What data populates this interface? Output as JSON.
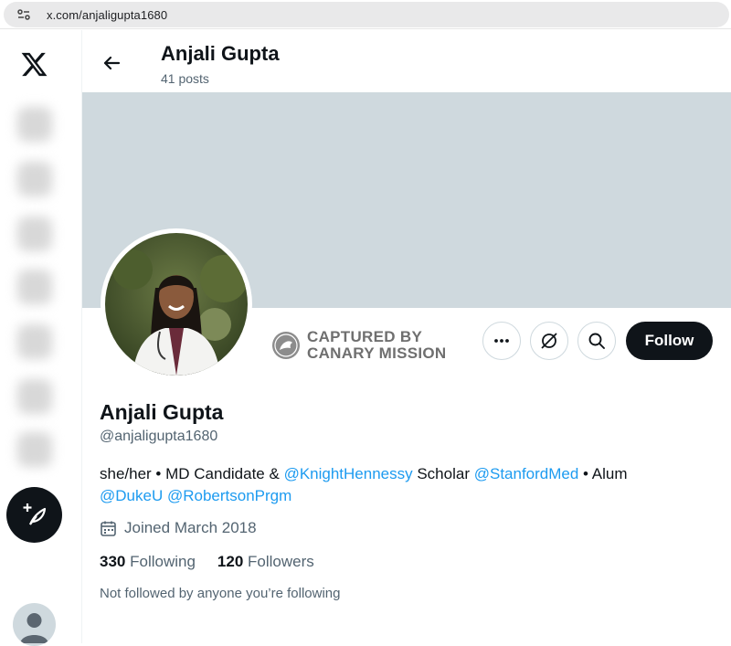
{
  "browser": {
    "url": "x.com/anjaligupta1680"
  },
  "header": {
    "name": "Anjali Gupta",
    "posts": "41 posts"
  },
  "captured": {
    "line1": "CAPTURED BY",
    "line2": "CANARY MISSION"
  },
  "actions": {
    "follow_label": "Follow"
  },
  "profile": {
    "name": "Anjali Gupta",
    "handle": "@anjaligupta1680",
    "bio": {
      "t1": "she/her • MD Candidate & ",
      "m1": "@KnightHennessy",
      "t2": " Scholar ",
      "m2": "@StanfordMed",
      "t3": " • Alum ",
      "m3": "@DukeU",
      "t4": " ",
      "m4": "@RobertsonPrgm"
    },
    "joined": "Joined March 2018",
    "following_count": "330",
    "following_label": "Following",
    "followers_count": "120",
    "followers_label": "Followers",
    "not_followed": "Not followed by anyone you’re following"
  },
  "icons": [
    "site-info-icon",
    "x-logo-icon",
    "compose-post-icon",
    "back-arrow-icon",
    "more-icon",
    "grok-icon",
    "search-icon",
    "calendar-icon",
    "canary-bird-icon"
  ],
  "colors": {
    "accent": "#1d9bf0",
    "banner": "#cfd9de",
    "button_dark": "#0f1419",
    "secondary_text": "#536471"
  }
}
